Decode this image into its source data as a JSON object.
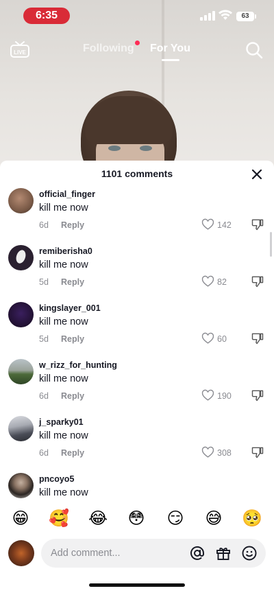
{
  "status_bar": {
    "time": "6:35",
    "battery": "63"
  },
  "nav": {
    "following_label": "Following",
    "for_you_label": "For You",
    "live_label": "LIVE"
  },
  "comments_sheet": {
    "title": "1101 comments",
    "reply_label": "Reply",
    "comments": [
      {
        "username": "official_finger",
        "text": "kill me now",
        "age": "6d",
        "likes": "142"
      },
      {
        "username": "remiberisha0",
        "text": "kill me now",
        "age": "5d",
        "likes": "82"
      },
      {
        "username": "kingslayer_001",
        "text": "kill me now",
        "age": "5d",
        "likes": "60"
      },
      {
        "username": "w_rizz_for_hunting",
        "text": "kill me now",
        "age": "6d",
        "likes": "190"
      },
      {
        "username": "j_sparky01",
        "text": "kill me now",
        "age": "6d",
        "likes": "308"
      },
      {
        "username": "pncoyo5",
        "text": "kill me now"
      }
    ]
  },
  "emoji_bar": [
    "😁",
    "🥰",
    "😂",
    "😳",
    "😏",
    "😅",
    "🥺"
  ],
  "input": {
    "placeholder": "Add comment..."
  },
  "colors": {
    "accent": "#fe2c55",
    "time_pill": "#d92b37",
    "muted": "#8a8b91",
    "text": "#161823"
  }
}
